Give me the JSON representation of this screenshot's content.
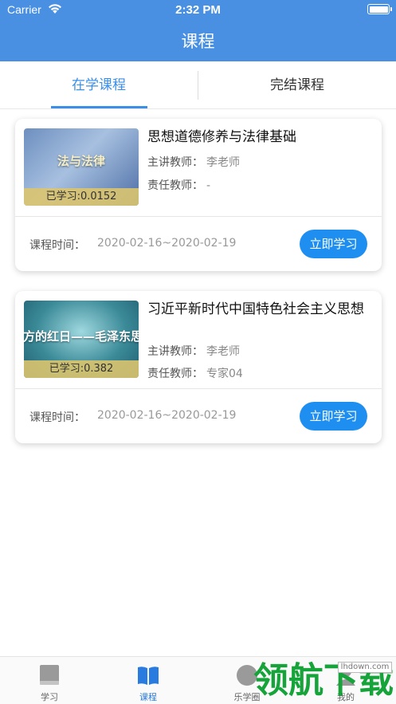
{
  "status_bar": {
    "carrier": "Carrier",
    "time": "2:32 PM"
  },
  "nav": {
    "title": "课程"
  },
  "tabs": [
    {
      "label": "在学课程",
      "active": true
    },
    {
      "label": "完结课程",
      "active": false
    }
  ],
  "courses": [
    {
      "title": "思想道德修养与法律基础",
      "thumb_text": "法与法律",
      "progress": "已学习:0.0152",
      "teacher_label": "主讲教师：",
      "teacher": "李老师",
      "owner_label": "责任教师：",
      "owner": "-",
      "time_label": "课程时间：",
      "time": "2020-02-16~2020-02-19",
      "button": "立即学习"
    },
    {
      "title": "习近平新时代中国特色社会主义思想",
      "thumb_text": "方的红日——毛泽东思",
      "progress": "已学习:0.382",
      "teacher_label": "主讲教师：",
      "teacher": "李老师",
      "owner_label": "责任教师：",
      "owner": "专家04",
      "time_label": "课程时间：",
      "time": "2020-02-16~2020-02-19",
      "button": "立即学习"
    }
  ],
  "tabbar": [
    {
      "label": "学习",
      "icon": "study-icon",
      "active": false
    },
    {
      "label": "课程",
      "icon": "book-icon",
      "active": true
    },
    {
      "label": "乐学圈",
      "icon": "circle-chat-icon",
      "active": false
    },
    {
      "label": "我的",
      "icon": "user-icon",
      "active": false
    }
  ],
  "watermark": {
    "text": "领航下载",
    "url": "lhdown.com"
  },
  "colors": {
    "header": "#4a90e2",
    "accent": "#1e8ff0",
    "tab_active": "#3b8fe6"
  }
}
